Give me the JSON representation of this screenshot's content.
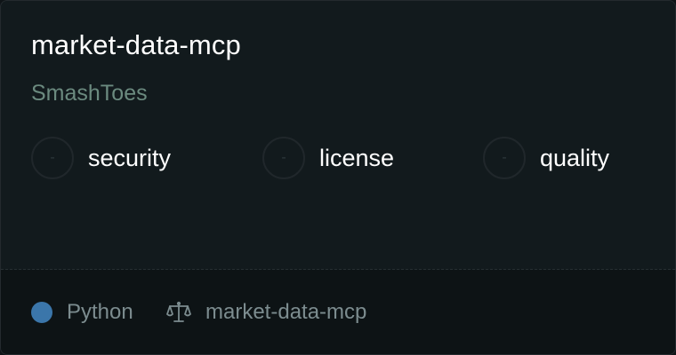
{
  "card": {
    "title": "market-data-mcp",
    "author": "SmashToes"
  },
  "metrics": [
    {
      "score": "-",
      "label": "security"
    },
    {
      "score": "-",
      "label": "license"
    },
    {
      "score": "-",
      "label": "quality"
    }
  ],
  "footer": {
    "language": "Python",
    "language_color": "#3b76aa",
    "license_icon": "balance-scale-icon",
    "license_name": "market-data-mcp"
  }
}
